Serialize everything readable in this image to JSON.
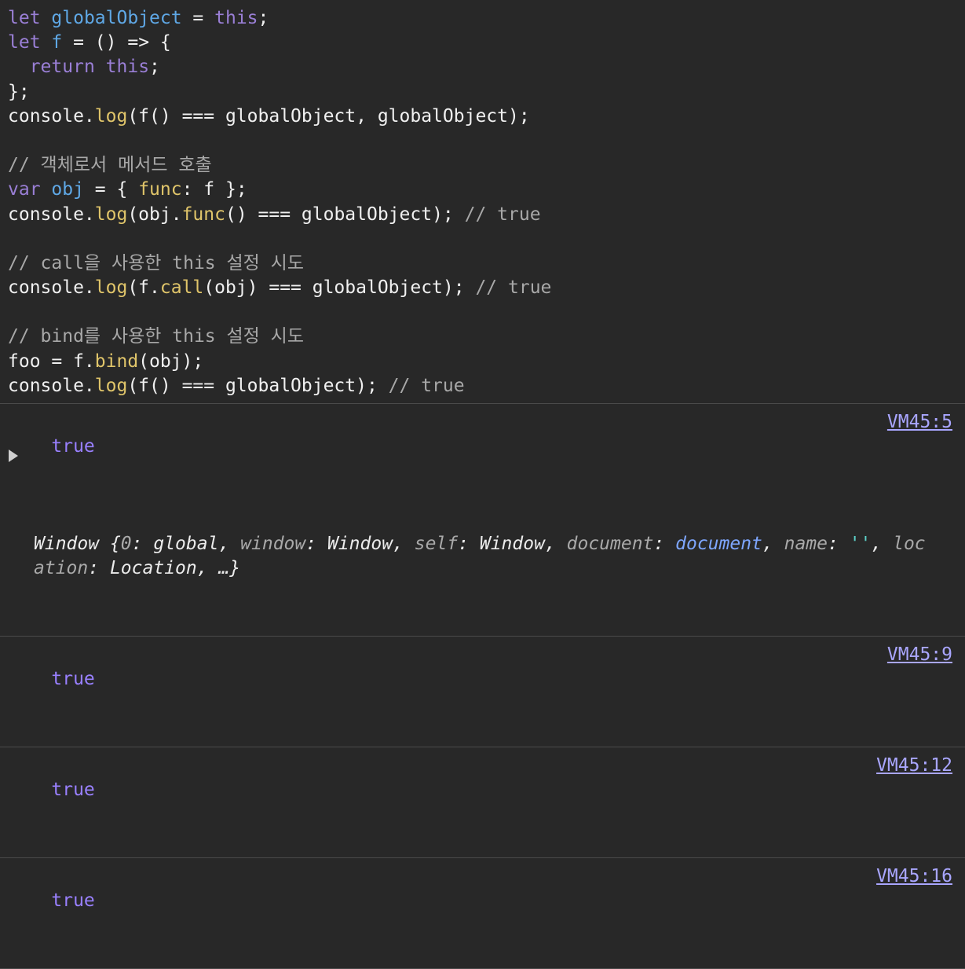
{
  "code": {
    "l1_kw1": "let",
    "l1_var": "globalObject",
    "l1_op": " = ",
    "l1_kw2": "this",
    "l1_end": ";",
    "l2_kw": "let",
    "l2_var": "f",
    "l2_rest": " = () => {",
    "l3_kw1": "return",
    "l3_kw2": "this",
    "l3_end": ";",
    "l4": "};",
    "l5_a": "console.",
    "l5_fn": "log",
    "l5_b": "(f() === globalObject, globalObject);",
    "l7_comment": "// 객체로서 메서드 호출",
    "l8_kw": "var",
    "l8_var": "obj",
    "l8_a": " = { ",
    "l8_fn": "func",
    "l8_b": ": f };",
    "l9_a": "console.",
    "l9_fn": "log",
    "l9_b": "(obj.",
    "l9_fn2": "func",
    "l9_c": "() === globalObject); ",
    "l9_comment": "// true",
    "l11_comment": "// call을 사용한 this 설정 시도",
    "l12_a": "console.",
    "l12_fn": "log",
    "l12_b": "(f.",
    "l12_fn2": "call",
    "l12_c": "(obj) === globalObject); ",
    "l12_comment": "// true",
    "l14_comment": "// bind를 사용한 this 설정 시도",
    "l15_a": "foo = f.",
    "l15_fn": "bind",
    "l15_b": "(obj);",
    "l16_a": "console.",
    "l16_fn": "log",
    "l16_b": "(f() === globalObject); ",
    "l16_comment": "// true"
  },
  "console": {
    "r1_value": "true",
    "r1_source": "VM45:5",
    "obj": {
      "name": "Window ",
      "open": "{",
      "k0": "0",
      "v0": "global",
      "k1": "window",
      "v1": "Window",
      "k2": "self",
      "v2": "Window",
      "k3": "document",
      "v3": "document",
      "k4": "name",
      "v4": "''",
      "k5": "location",
      "v5": "Location",
      "close": ", …}"
    },
    "r2_value": "true",
    "r2_source": "VM45:9",
    "r3_value": "true",
    "r3_source": "VM45:12",
    "r4_value": "true",
    "r4_source": "VM45:16"
  }
}
